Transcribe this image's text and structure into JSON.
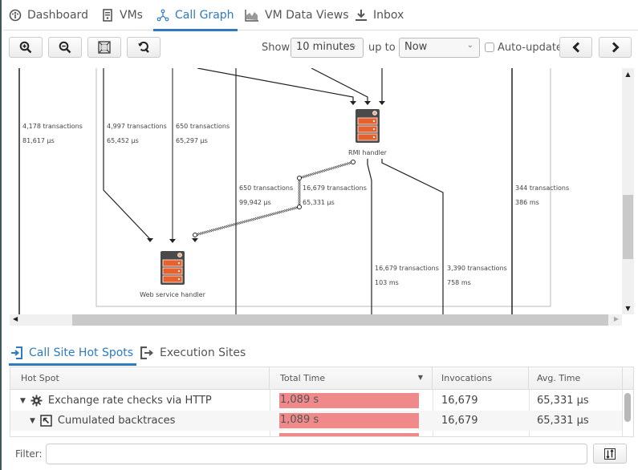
{
  "tabs": [
    {
      "label": "Dashboard",
      "icon": "dashboard-icon",
      "active": false
    },
    {
      "label": "VMs",
      "icon": "vm-icon",
      "active": false
    },
    {
      "label": "Call Graph",
      "icon": "call-graph-icon",
      "active": true
    },
    {
      "label": "VM Data Views",
      "icon": "chart-area-icon",
      "active": false
    },
    {
      "label": "Inbox",
      "icon": "download-icon",
      "active": false
    }
  ],
  "toolbar": {
    "zoom_in": "zoom-in",
    "zoom_out": "zoom-out",
    "fit": "fit-to-window",
    "reset": "reset-zoom",
    "show_label": "Show",
    "show_value": "10 minutes",
    "upto_label": "up to",
    "upto_value": "Now",
    "auto_update_label": "Auto-update",
    "auto_update_checked": false
  },
  "graph": {
    "nodes": [
      {
        "label": "RMI handler"
      },
      {
        "label": "Web service handler"
      }
    ],
    "edges": [
      {
        "transactions": "4,178 transactions",
        "time": "81,617 µs"
      },
      {
        "transactions": "4,997 transactions",
        "time": "65,452 µs"
      },
      {
        "transactions": "650 transactions",
        "time": "65,297 µs"
      },
      {
        "transactions": "650 transactions",
        "time": "99,942 µs"
      },
      {
        "transactions": "16,679 transactions",
        "time": "65,331 µs"
      },
      {
        "transactions": "344 transactions",
        "time": "386 ms"
      },
      {
        "transactions": "16,679 transactions",
        "time": "103 ms"
      },
      {
        "transactions": "3,390 transactions",
        "time": "758 ms"
      }
    ]
  },
  "bottom_tabs": [
    {
      "label": "Call Site Hot Spots",
      "active": true
    },
    {
      "label": "Execution Sites",
      "active": false
    }
  ],
  "table": {
    "columns": [
      "Hot Spot",
      "Total Time",
      "Invocations",
      "Avg. Time"
    ],
    "sorted_column": "Total Time",
    "rows": [
      {
        "name": "Exchange rate checks via HTTP",
        "icon": "gear-icon",
        "total_time": "1,089 s",
        "total_fraction": 1.0,
        "invocations": "16,679",
        "avg_time": "65,331 µs"
      },
      {
        "name": "Cumulated backtraces",
        "icon": "backtrace-icon",
        "total_time": "1,089 s",
        "total_fraction": 1.0,
        "invocations": "16,679",
        "avg_time": "65,331 µs"
      }
    ]
  },
  "filter": {
    "label": "Filter:",
    "value": "",
    "placeholder": ""
  },
  "colors": {
    "accent": "#2e7bbf",
    "bar": "#f08a8a",
    "node_orange": "#e8602c",
    "node_dark": "#4a4a4a"
  }
}
